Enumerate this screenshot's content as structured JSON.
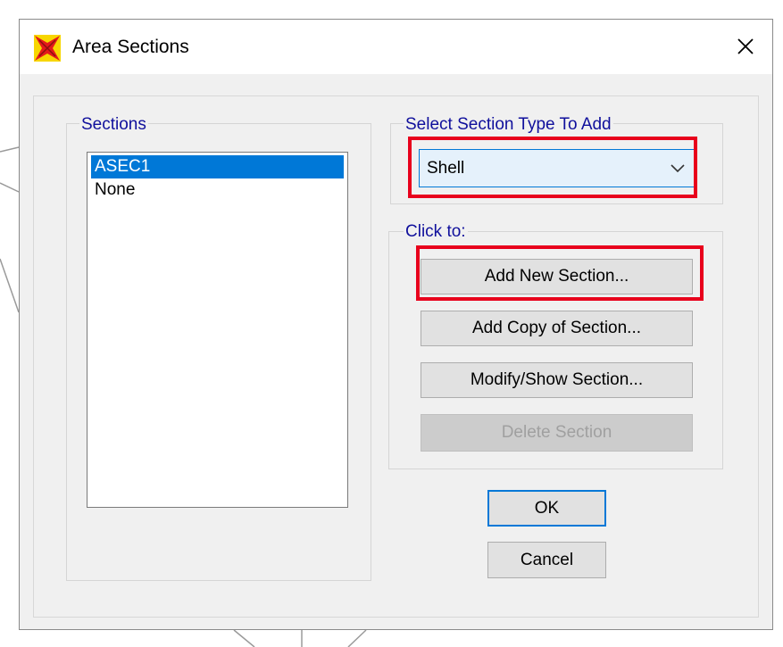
{
  "window": {
    "title": "Area Sections",
    "close_glyph": "✕",
    "icons": {
      "app": "sap2000-app-icon",
      "close": "close-icon"
    }
  },
  "sections": {
    "label": "Sections",
    "items": [
      {
        "label": "ASEC1",
        "selected": true
      },
      {
        "label": "None",
        "selected": false
      }
    ]
  },
  "section_type": {
    "label": "Select Section Type To Add",
    "selected": "Shell",
    "icon": "chevron-down-icon"
  },
  "actions": {
    "label": "Click to:",
    "add_new": "Add New Section...",
    "add_copy": "Add Copy of Section...",
    "modify_show": "Modify/Show Section...",
    "delete": "Delete Section"
  },
  "footer": {
    "ok": "OK",
    "cancel": "Cancel"
  },
  "colors": {
    "highlight": "#e8001c",
    "selection": "#0078d7",
    "group_label": "#10109c",
    "dialog_bg": "#f0f0f0"
  }
}
